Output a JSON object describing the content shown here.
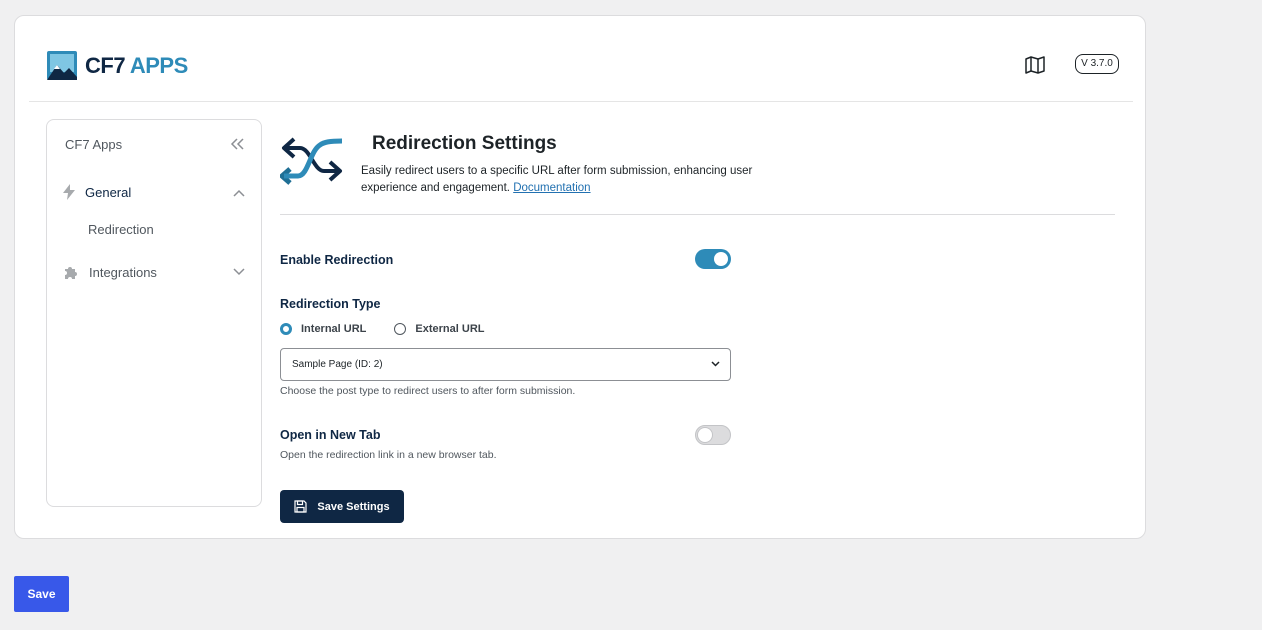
{
  "header": {
    "logo_text_primary": "CF7",
    "logo_text_accent": "APPS",
    "version": "V 3.7.0",
    "docs_icon": "book-map-icon"
  },
  "sidebar": {
    "title": "CF7 Apps",
    "items": [
      {
        "label": "General",
        "icon": "lightning-icon",
        "expanded": true
      },
      {
        "label": "Redirection"
      },
      {
        "label": "Integrations",
        "icon": "puzzle-icon",
        "expanded": false
      }
    ]
  },
  "main": {
    "title": "Redirection Settings",
    "description": "Easily redirect users to a specific URL after form submission, enhancing user experience and engagement.",
    "doc_link": "Documentation",
    "enable_redirection": {
      "label": "Enable Redirection",
      "value": true
    },
    "redirection_type": {
      "label": "Redirection Type",
      "options": [
        "Internal URL",
        "External URL"
      ],
      "selected": "Internal URL"
    },
    "page_select": {
      "value": "Sample Page (ID: 2)",
      "hint": "Choose the post type to redirect users to after form submission."
    },
    "open_new_tab": {
      "label": "Open in New Tab",
      "value": false,
      "hint": "Open the redirection link in a new browser tab."
    },
    "save_settings_label": "Save Settings"
  },
  "footer": {
    "save_label": "Save"
  },
  "colors": {
    "brand_dark": "#0f2744",
    "brand_accent": "#2e8bb8",
    "wp_blue": "#3858e9"
  }
}
